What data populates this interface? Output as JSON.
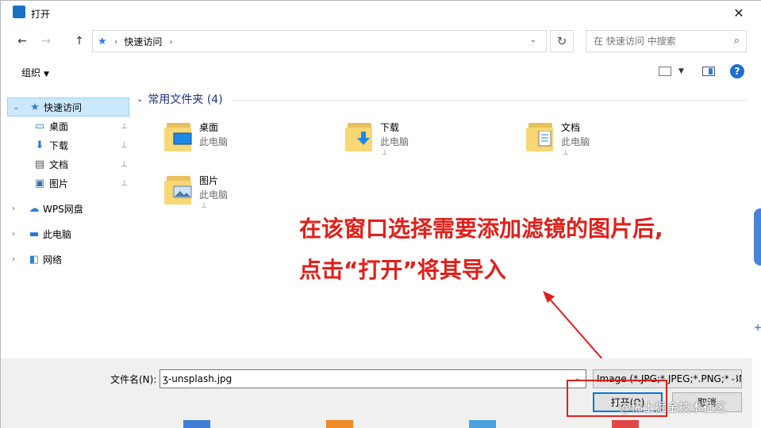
{
  "window": {
    "title": "打开",
    "close_glyph": "✕"
  },
  "navigation": {
    "back_glyph": "←",
    "forward_glyph": "→",
    "up_glyph": "↑",
    "address_sep": "›",
    "address_crumb": "快速访问",
    "address_dropdown": "⌄",
    "refresh_glyph": "↻",
    "search_placeholder": "在 快速访问 中搜索",
    "search_glyph": "⌕"
  },
  "toolbar": {
    "organize_label": "组织",
    "organize_caret": "▼",
    "view_caret": "▼",
    "help_label": "?"
  },
  "sidebar": {
    "items": [
      {
        "label": "快速访问",
        "icon": "star-icon",
        "glyph": "★",
        "expander": "⌄",
        "pinned": false,
        "selected": true
      },
      {
        "label": "桌面",
        "icon": "desktop-icon",
        "glyph": "▭",
        "pinned": true
      },
      {
        "label": "下载",
        "icon": "download-icon",
        "glyph": "⬇",
        "pinned": true
      },
      {
        "label": "文档",
        "icon": "document-icon",
        "glyph": "▤",
        "pinned": true
      },
      {
        "label": "图片",
        "icon": "picture-icon",
        "glyph": "▣",
        "pinned": true
      },
      {
        "label": "WPS网盘",
        "icon": "cloud-icon",
        "glyph": "☁",
        "expander": "›"
      },
      {
        "label": "此电脑",
        "icon": "computer-icon",
        "glyph": "▬",
        "expander": "›"
      },
      {
        "label": "网络",
        "icon": "network-icon",
        "glyph": "◧",
        "expander": "›"
      }
    ],
    "pin_glyph": "⊥"
  },
  "content": {
    "group_title": "常用文件夹 (4)",
    "group_chevron": "⌄",
    "folders": [
      {
        "name": "桌面",
        "location": "此电脑"
      },
      {
        "name": "下载",
        "location": "此电脑"
      },
      {
        "name": "文档",
        "location": "此电脑"
      },
      {
        "name": "图片",
        "location": "此电脑"
      }
    ],
    "pin_glyph": "⊥"
  },
  "annotation": {
    "line1": "在该窗口选择需要添加滤镜的图片后,",
    "line2": "点击“打开”将其导入",
    "color": "#e0201b"
  },
  "footer": {
    "filename_label": "文件名(N):",
    "filename_value": "ʒ-unsplash.jpg",
    "filename_dropdown": "⌄",
    "filter_value": "Image (*.JPG;*.JPEG;*.PNG;*.BMP)",
    "filter_dropdown": "⌄",
    "open_label": "打开(O)",
    "cancel_label": "取消"
  },
  "watermark": "@稀土掘金技术社区",
  "colors": {
    "accent": "#0078d7",
    "selection": "#cce8ff",
    "folder": "#f8d775",
    "annotation": "#e0201b"
  }
}
